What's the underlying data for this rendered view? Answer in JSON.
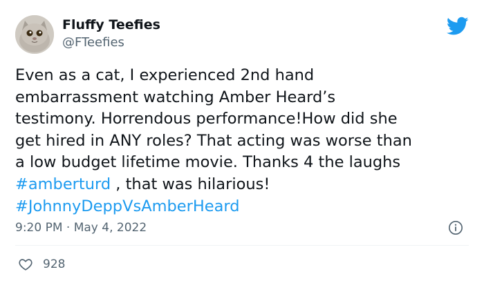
{
  "author": {
    "display_name": "Fluffy Teefies",
    "handle": "@FTeefies",
    "avatar_icon": "cat-avatar"
  },
  "brand": {
    "logo_icon": "twitter-bird-icon",
    "accent_color": "#1d9bf0"
  },
  "tweet": {
    "text_segments": [
      {
        "text": "Even as a cat, I experienced 2nd hand\nembarrassment watching Amber Heard’s\ntestimony. Horrendous performance!How did she\nget hired in ANY roles? That acting was worse than\na low budget lifetime movie. Thanks 4 the laughs\n",
        "kind": "text"
      },
      {
        "text": "#amberturd",
        "kind": "hashtag"
      },
      {
        "text": " , that was hilarious!\n",
        "kind": "text"
      },
      {
        "text": "#JohnnyDeppVsAmberHeard",
        "kind": "hashtag"
      }
    ],
    "timestamp": "9:20 PM · May 4, 2022"
  },
  "actions": {
    "like_icon": "heart-icon",
    "like_count": "928",
    "info_icon": "info-icon"
  }
}
